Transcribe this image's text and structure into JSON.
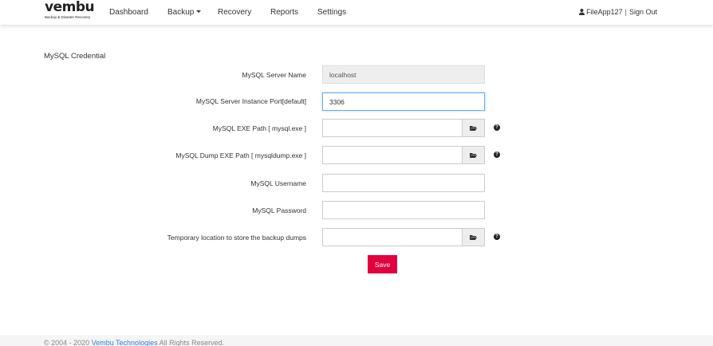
{
  "brand": {
    "name": "vembu",
    "tagline": "Backup & Disaster Recovery"
  },
  "nav": {
    "dashboard": "Dashboard",
    "backup": "Backup",
    "recovery": "Recovery",
    "reports": "Reports",
    "settings": "Settings"
  },
  "user": {
    "name": "FileApp127",
    "separator": "|",
    "sign_out": "Sign Out"
  },
  "form": {
    "title": "MySQL Credential",
    "server_name": {
      "label": "MySQL Server Name",
      "value": "localhost"
    },
    "port": {
      "label": "MySQL Server Instance Port[default]",
      "value": "3306"
    },
    "exe_path": {
      "label": "MySQL EXE Path [ mysql.exe ]",
      "value": ""
    },
    "dump_path": {
      "label": "MySQL Dump EXE Path [ mysqldump.exe ]",
      "value": ""
    },
    "username": {
      "label": "MySQL Username",
      "value": ""
    },
    "password": {
      "label": "MySQL Password",
      "value": ""
    },
    "temp_location": {
      "label": "Temporary location to store the backup dumps",
      "value": ""
    },
    "help_glyph": "?",
    "save_label": "Save"
  },
  "footer": {
    "prefix": "© 2004 - 2020 ",
    "company": "Vembu Technologies",
    "suffix": " All Rights Reserved."
  },
  "icons": {
    "user": "user-icon",
    "folder": "folder-open-icon",
    "help": "question-circle-icon"
  },
  "colors": {
    "accent": "#e2003f",
    "link": "#3a7bd5",
    "focus": "#66afe9"
  }
}
